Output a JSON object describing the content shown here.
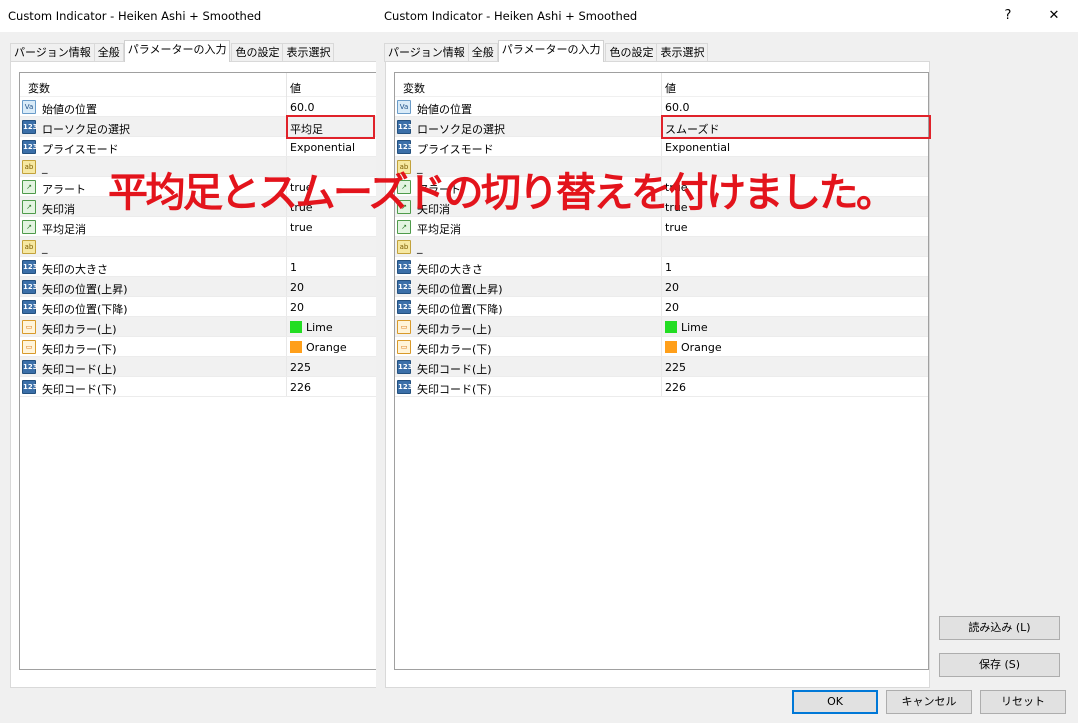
{
  "left_dialog": {
    "title": "Custom Indicator - Heiken Ashi + Smoothed",
    "tabs": [
      "パージョン情報",
      "全般",
      "パラメーターの入力",
      "色の設定",
      "表示選択"
    ],
    "active_tab": "パラメーターの入力",
    "columns": {
      "variable": "変数",
      "value": "値"
    },
    "rows": [
      {
        "type": "double",
        "icon_text": "Va",
        "name": "始値の位置",
        "value": "60.0"
      },
      {
        "type": "int",
        "icon_text": "123",
        "name": "ローソク足の選択",
        "value": "平均足"
      },
      {
        "type": "int",
        "icon_text": "123",
        "name": "プライスモード",
        "value": "Exponential"
      },
      {
        "type": "string",
        "icon_text": "ab",
        "name": "_",
        "value": ""
      },
      {
        "type": "bool",
        "icon_text": "↗",
        "name": "アラート",
        "value": "true"
      },
      {
        "type": "bool",
        "icon_text": "↗",
        "name": "矢印消",
        "value": "true"
      },
      {
        "type": "bool",
        "icon_text": "↗",
        "name": "平均足消",
        "value": "true"
      },
      {
        "type": "string",
        "icon_text": "ab",
        "name": "_",
        "value": ""
      },
      {
        "type": "int",
        "icon_text": "123",
        "name": "矢印の大きさ",
        "value": "1"
      },
      {
        "type": "int",
        "icon_text": "123",
        "name": "矢印の位置(上昇)",
        "value": "20"
      },
      {
        "type": "int",
        "icon_text": "123",
        "name": "矢印の位置(下降)",
        "value": "20"
      },
      {
        "type": "color",
        "icon_text": "▭",
        "name": "矢印カラー(上)",
        "value": "Lime",
        "color": "#22dd22"
      },
      {
        "type": "color",
        "icon_text": "▭",
        "name": "矢印カラー(下)",
        "value": "Orange",
        "color": "#ff9f1a"
      },
      {
        "type": "int",
        "icon_text": "123",
        "name": "矢印コード(上)",
        "value": "225"
      },
      {
        "type": "int",
        "icon_text": "123",
        "name": "矢印コード(下)",
        "value": "226"
      }
    ]
  },
  "right_dialog": {
    "title": "Custom Indicator - Heiken Ashi + Smoothed",
    "help_label": "?",
    "close_label": "✕",
    "tabs": [
      "パージョン情報",
      "全般",
      "パラメーターの入力",
      "色の設定",
      "表示選択"
    ],
    "active_tab": "パラメーターの入力",
    "columns": {
      "variable": "変数",
      "value": "値"
    },
    "rows": [
      {
        "type": "double",
        "icon_text": "Va",
        "name": "始値の位置",
        "value": "60.0"
      },
      {
        "type": "int",
        "icon_text": "123",
        "name": "ローソク足の選択",
        "value": "スムーズド"
      },
      {
        "type": "int",
        "icon_text": "123",
        "name": "プライスモード",
        "value": "Exponential"
      },
      {
        "type": "string",
        "icon_text": "ab",
        "name": "_",
        "value": ""
      },
      {
        "type": "bool",
        "icon_text": "↗",
        "name": "アラート",
        "value": "true"
      },
      {
        "type": "bool",
        "icon_text": "↗",
        "name": "矢印消",
        "value": "true"
      },
      {
        "type": "bool",
        "icon_text": "↗",
        "name": "平均足消",
        "value": "true"
      },
      {
        "type": "string",
        "icon_text": "ab",
        "name": "_",
        "value": ""
      },
      {
        "type": "int",
        "icon_text": "123",
        "name": "矢印の大きさ",
        "value": "1"
      },
      {
        "type": "int",
        "icon_text": "123",
        "name": "矢印の位置(上昇)",
        "value": "20"
      },
      {
        "type": "int",
        "icon_text": "123",
        "name": "矢印の位置(下降)",
        "value": "20"
      },
      {
        "type": "color",
        "icon_text": "▭",
        "name": "矢印カラー(上)",
        "value": "Lime",
        "color": "#22dd22"
      },
      {
        "type": "color",
        "icon_text": "▭",
        "name": "矢印カラー(下)",
        "value": "Orange",
        "color": "#ff9f1a"
      },
      {
        "type": "int",
        "icon_text": "123",
        "name": "矢印コード(上)",
        "value": "225"
      },
      {
        "type": "int",
        "icon_text": "123",
        "name": "矢印コード(下)",
        "value": "226"
      }
    ],
    "side_buttons": {
      "load": "読み込み (L)",
      "save": "保存 (S)"
    },
    "footer_buttons": {
      "ok": "OK",
      "cancel": "キャンセル",
      "reset": "リセット"
    }
  },
  "annotation": {
    "caption": "平均足とスムーズドの切り替えを付けました。",
    "highlight_color": "#e0222a"
  }
}
